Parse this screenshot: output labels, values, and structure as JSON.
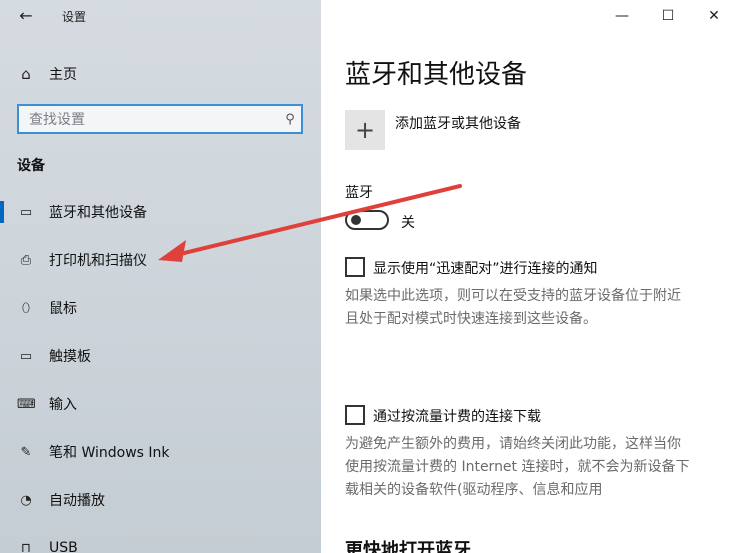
{
  "window": {
    "title": "设置"
  },
  "sidebar": {
    "home_label": "主页",
    "search_placeholder": "查找设置",
    "section_title": "设备",
    "items": [
      {
        "label": "蓝牙和其他设备",
        "icon": "bluetooth-devices-icon",
        "selected": true
      },
      {
        "label": "打印机和扫描仪",
        "icon": "printer-icon",
        "selected": false
      },
      {
        "label": "鼠标",
        "icon": "mouse-icon",
        "selected": false
      },
      {
        "label": "触摸板",
        "icon": "touchpad-icon",
        "selected": false
      },
      {
        "label": "输入",
        "icon": "keyboard-icon",
        "selected": false
      },
      {
        "label": "笔和 Windows Ink",
        "icon": "pen-icon",
        "selected": false
      },
      {
        "label": "自动播放",
        "icon": "autoplay-icon",
        "selected": false
      },
      {
        "label": "USB",
        "icon": "usb-icon",
        "selected": false
      }
    ]
  },
  "main": {
    "title": "蓝牙和其他设备",
    "add_device_label": "添加蓝牙或其他设备",
    "bluetooth_heading": "蓝牙",
    "bluetooth_state": "关",
    "swift_pair": {
      "label": "显示使用“迅速配对”进行连接的通知",
      "description_line1": "如果选中此选项，则可以在受支持的蓝牙设备位于附近",
      "description_line2": "且处于配对模式时快速连接到这些设备。",
      "checked": false
    },
    "metered": {
      "label": "通过按流量计费的连接下载",
      "description_line1": "为避免产生额外的费用，请始终关闭此功能，这样当你",
      "description_line2": "使用按流量计费的 Internet 连接时，就不会为新设备下",
      "description_line3": "载相关的设备软件(驱动程序、信息和应用",
      "checked": false
    },
    "next_heading": "更快地打开蓝牙"
  },
  "annotation": {
    "arrow_color": "#e0403a"
  }
}
